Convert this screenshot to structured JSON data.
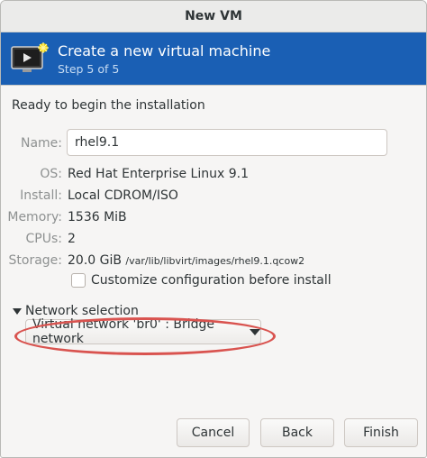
{
  "window": {
    "title": "New VM"
  },
  "header": {
    "title": "Create a new virtual machine",
    "step": "Step 5 of 5",
    "icon": "monitor-icon"
  },
  "summary": {
    "heading": "Ready to begin the installation",
    "name_label": "Name:",
    "name_value": "rhel9.1",
    "os_label": "OS:",
    "os_value": "Red Hat Enterprise Linux 9.1",
    "install_label": "Install:",
    "install_value": "Local CDROM/ISO",
    "memory_label": "Memory:",
    "memory_value": "1536 MiB",
    "cpus_label": "CPUs:",
    "cpus_value": "2",
    "storage_label": "Storage:",
    "storage_size": "20.0 GiB",
    "storage_path": "/var/lib/libvirt/images/rhel9.1.qcow2",
    "customize_label": "Customize configuration before install",
    "customize_checked": false
  },
  "network": {
    "expander_label": "Network selection",
    "selected": "Virtual network 'br0' : Bridge network"
  },
  "buttons": {
    "cancel": "Cancel",
    "back": "Back",
    "finish": "Finish"
  },
  "colors": {
    "header_bg": "#1a5fb4",
    "highlight_ellipse": "#d9534f"
  }
}
